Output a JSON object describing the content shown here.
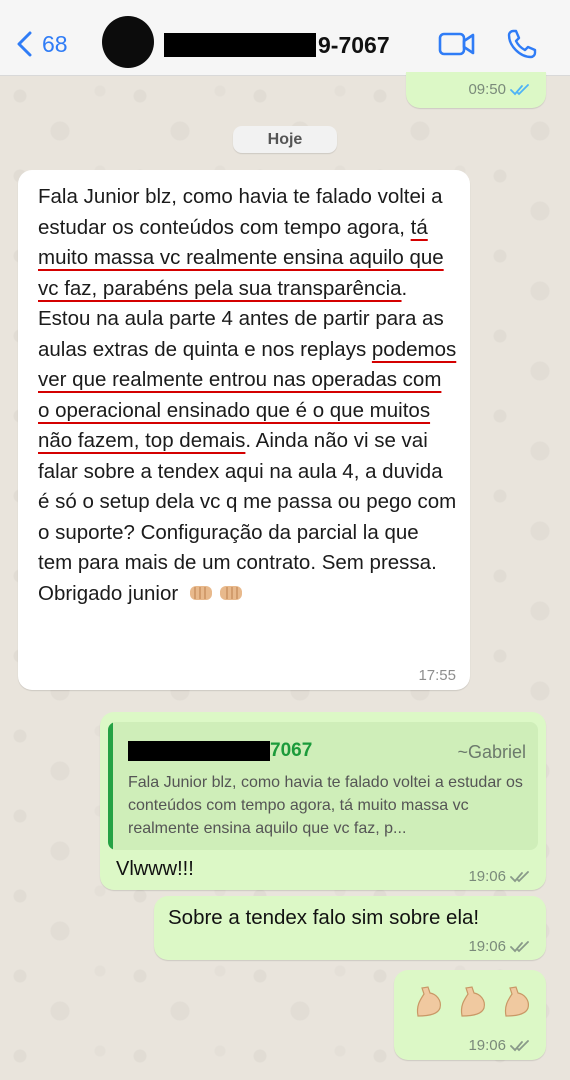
{
  "header": {
    "back_count": "68",
    "contact_number_visible": "9-7067"
  },
  "messages": {
    "top_time": "09:50",
    "date_chip": "Hoje",
    "long": {
      "seg1": "Fala Junior blz, como havia te falado voltei a estudar os conteúdos com tempo agora, ",
      "seg2": "tá muito massa vc realmente ensina aquilo que vc faz, parabéns pela sua transparência",
      "seg3": ". Estou na aula parte 4 antes de partir para as aulas extras de quinta e nos replays ",
      "seg4": "podemos ver que realmente entrou nas operadas com o operacional ensinado que é o que muitos não fazem, top demais",
      "seg5": ". Ainda não vi se vai falar sobre a tendex aqui na aula 4, a duvida é só o setup dela vc q me passa ou pego com o suporte? Configuração da parcial la que tem para mais de um contrato. Sem pressa. Obrigado junior",
      "time": "17:55"
    },
    "reply": {
      "quote_number_visible": "7067",
      "quote_name": "~Gabriel",
      "quote_text": "Fala Junior blz, como havia te falado voltei a estudar os conteúdos com tempo agora, tá muito massa vc realmente ensina aquilo que vc faz, p...",
      "text": "Vlwww!!!",
      "time": "19:06"
    },
    "tendex": {
      "text": "Sobre a tendex falo sim sobre ela!",
      "time": "19:06"
    },
    "arms": {
      "time": "19:06"
    }
  },
  "colors": {
    "accent": "#2f7cf6",
    "outgoing_bubble": "#dcf8c6",
    "quote_green": "#1c9b3b",
    "underline": "#d40000"
  },
  "icons": [
    "chevron-left-icon",
    "video-icon",
    "phone-icon",
    "double-check-icon",
    "fist-bump-emoji",
    "flexed-biceps-emoji"
  ]
}
